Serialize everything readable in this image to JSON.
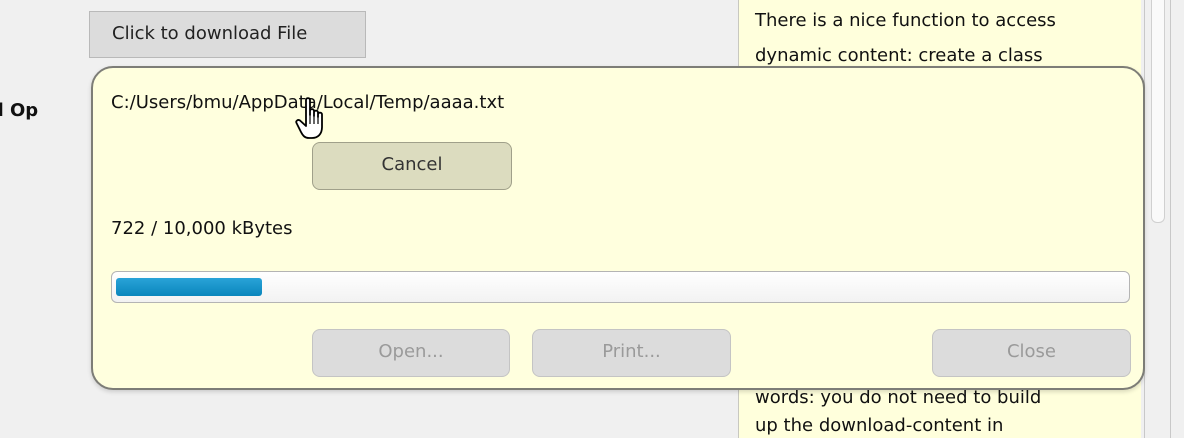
{
  "background_page": {
    "download_button_label": "Click to download File",
    "side_label": "nd Op",
    "right_panel_lines": [
      "There is a nice function to access",
      "dynamic content: create a class",
      "words: you do not need to build",
      "up the download-content in"
    ]
  },
  "dialog": {
    "file_path": "C:/Users/bmu/AppData/Local/Temp/aaaa.txt",
    "cancel_label": "Cancel",
    "progress_text": "722 / 10,000 kBytes",
    "progress_fraction": 0.0722,
    "open_label": "Open...",
    "print_label": "Print...",
    "close_label": "Close"
  },
  "colors": {
    "accent": "#0a86bc",
    "dialog_bg": "#ffffde",
    "panel_bg": "#ffffdc"
  },
  "icons": {
    "cursor": "hand-pointer-icon"
  }
}
